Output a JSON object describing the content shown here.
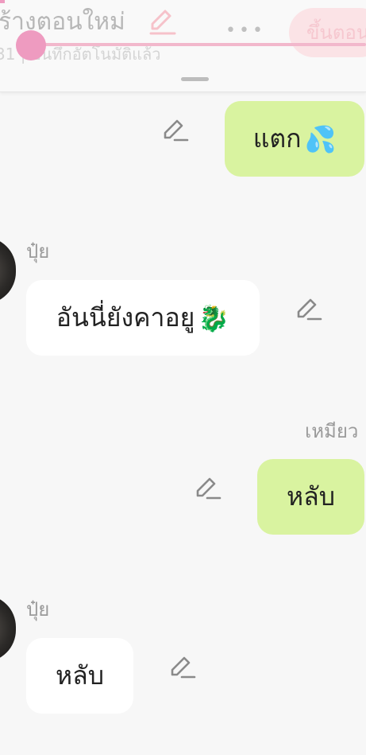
{
  "header": {
    "title": "ร้างตอนใหม่",
    "subtitle": "31 | บันทึกอัตโนมัติแล้ว",
    "more_label": "•••",
    "publish_label": "ขึ้นตอน",
    "accent_color": "#ee9bc0"
  },
  "messages": [
    {
      "side": "right",
      "text": "แตก",
      "emoji": "💦"
    },
    {
      "side": "left",
      "sender": "ปุ๋ย",
      "text": "อันนี่ยังคาอยู",
      "emoji": "🐉"
    },
    {
      "side": "right",
      "sender": "เหมียว",
      "text": "หลับ"
    },
    {
      "side": "left",
      "sender": "ปุ๋ย",
      "text": "หลับ"
    }
  ],
  "icons": {
    "edit": "pencil-icon",
    "more": "more-horizontal-icon"
  },
  "colors": {
    "right_bubble": "#d9f3a0",
    "left_bubble": "#ffffff",
    "background": "#f7f7f7"
  }
}
